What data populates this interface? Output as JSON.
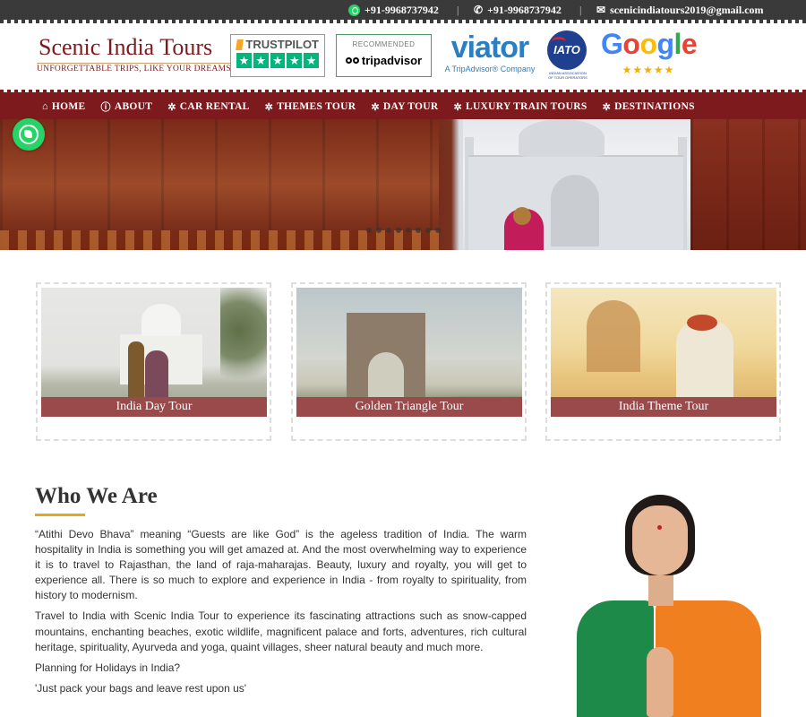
{
  "topbar": {
    "whatsapp": "+91-9968737942",
    "phone": "+91-9968737942",
    "email": "scenicindiatours2019@gmail.com",
    "separator": "|"
  },
  "brand": {
    "name": "Scenic India Tours",
    "tagline": "UNFORGETTABLE TRIPS, LIKE YOUR DREAMS",
    "color": "#7d1a1d"
  },
  "badges": {
    "trustpilot": "TRUSTPILOT",
    "tripadvisor_recommended": "RECOMMENDED",
    "tripadvisor": "tripadvisor",
    "viator": "viator",
    "viator_sub": "A TripAdvisor® Company",
    "iato": "IATO",
    "iato_caption": "INDIAN ASSOCIATION OF TOUR OPERATORS",
    "google": "Google",
    "google_stars": "★★★★★"
  },
  "nav": {
    "items": [
      {
        "label": "HOME",
        "icon": "home-icon"
      },
      {
        "label": "ABOUT",
        "icon": "info-icon"
      },
      {
        "label": "CAR RENTAL",
        "icon": "gear-icon"
      },
      {
        "label": "THEMES TOUR",
        "icon": "gear-icon"
      },
      {
        "label": "DAY TOUR",
        "icon": "gear-icon"
      },
      {
        "label": "LUXURY TRAIN TOURS",
        "icon": "gear-icon"
      },
      {
        "label": "DESTINATIONS",
        "icon": "gear-icon"
      }
    ]
  },
  "tours": [
    {
      "label": "India Day Tour"
    },
    {
      "label": "Golden Triangle Tour"
    },
    {
      "label": "India Theme Tour"
    }
  ],
  "who": {
    "title": "Who We Are",
    "p1": "“Atithi Devo Bhava” meaning “Guests are like God” is the ageless tradition of India. The warm hospitality in India is something you will get amazed at. And the most overwhelming way to experience it is to travel to Rajasthan, the land of raja-maharajas. Beauty, luxury and royalty, you will get to experience all. There is so much to explore and experience in India - from royalty to spirituality, from history to modernism.",
    "p2": "Travel to India with Scenic India Tour to experience its fascinating attractions such as snow-capped mountains, enchanting beaches, exotic wildlife, magnificent palace and forts, adventures, rich cultural heritage, spirituality, Ayurveda and yoga, quaint villages, sheer natural beauty and much more.",
    "p3": "Planning for Holidays in India?",
    "p4": "'Just pack your bags and leave rest upon us'"
  },
  "colors": {
    "nav_bg": "#7d1a1d",
    "accent_underline": "#e3a81c",
    "card_label_bg": "#9a4a4a",
    "whatsapp": "#25d366"
  }
}
